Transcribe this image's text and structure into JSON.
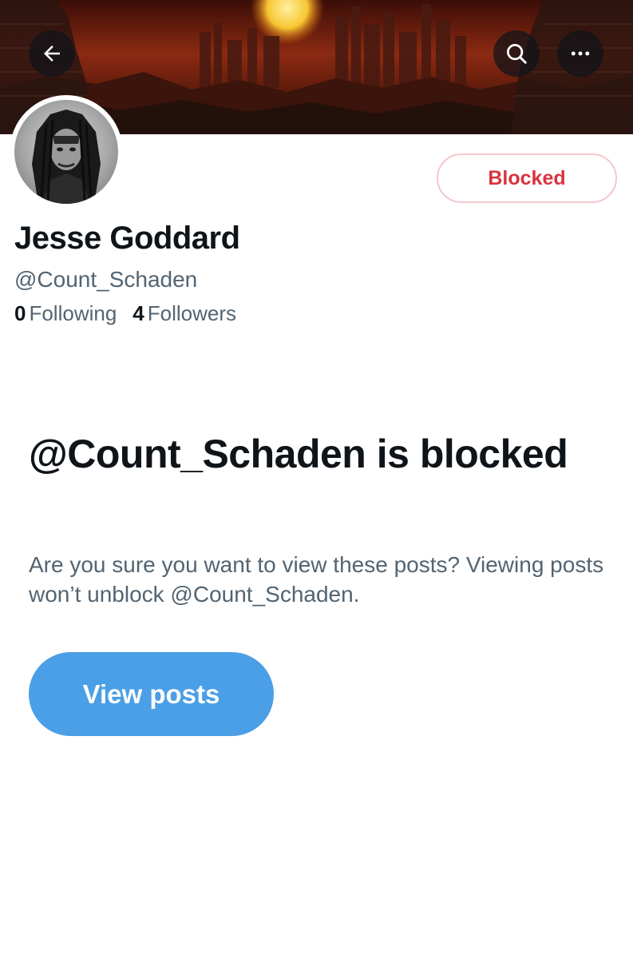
{
  "header": {
    "back_icon": "arrow-left-icon",
    "search_icon": "search-icon",
    "more_icon": "more-horizontal-icon"
  },
  "profile": {
    "display_name": "Jesse Goddard",
    "handle": "@Count_Schaden",
    "blocked_button_label": "Blocked",
    "following_count": "0",
    "following_label": "Following",
    "followers_count": "4",
    "followers_label": "Followers"
  },
  "blocked_notice": {
    "title": "@Count_Schaden is blocked",
    "description": "Are you sure you want to view these posts? Viewing posts won’t unblock @Count_Schaden.",
    "view_posts_label": "View posts"
  },
  "colors": {
    "accent_blue": "#4a9fe6",
    "blocked_red": "#d7343f",
    "text_primary": "#0f1419",
    "text_secondary": "#536471"
  }
}
